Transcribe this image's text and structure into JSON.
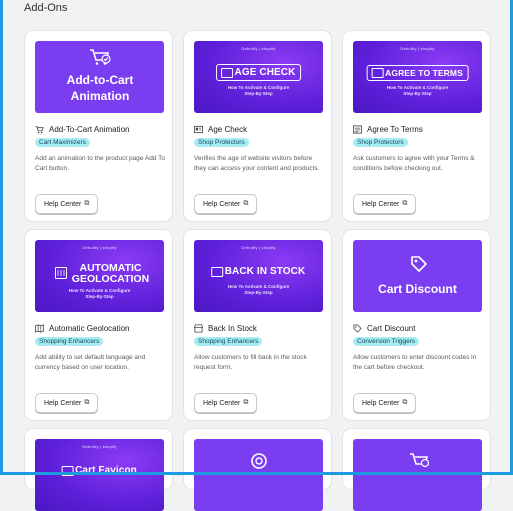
{
  "page": {
    "title": "Add-Ons"
  },
  "brand": "Debutify | shopify",
  "subtitle": "How To Activate & Configure Step-By-Step",
  "help_label": "Help Center",
  "cards": [
    {
      "title": "Add-To-Cart Animation",
      "badge": "Cart Maximizers",
      "desc": "Add an animation to the product page Add To Cart button.",
      "banner": "Add-to-Cart Animation",
      "icon": "cart-check-icon"
    },
    {
      "title": "Age Check",
      "badge": "Shop Protectors",
      "desc": "Verifies the age of website visitors before they can access your content and products.",
      "banner": "AGE CHECK",
      "icon": "id-card-icon"
    },
    {
      "title": "Agree To Terms",
      "badge": "Shop Protectors",
      "desc": "Ask customers to agree with your Terms & conditions before checking out.",
      "banner": "AGREE TO TERMS",
      "icon": "terms-checklist-icon"
    },
    {
      "title": "Automatic Geolocation",
      "badge": "Shopping Enhancers",
      "desc": "Add ability to set default language and currency based on user location.",
      "banner_line1": "AUTOMATIC",
      "banner_line2": "GEOLOCATION",
      "icon": "map-icon"
    },
    {
      "title": "Back In Stock",
      "badge": "Shopping Enhancers",
      "desc": "Allow customers to fill back in the stock request form.",
      "banner": "BACK IN STOCK",
      "icon": "store-icon"
    },
    {
      "title": "Cart Discount",
      "badge": "Conversion Triggers",
      "desc": "Allow customers to enter discount codes in the cart before checkout.",
      "banner": "Cart Discount",
      "icon": "tag-icon"
    },
    {
      "banner": "Cart Favicon"
    }
  ],
  "colors": {
    "accent": "#1e9be0",
    "banner": "#6c2ce8",
    "badge_bg": "#a7ecf3"
  }
}
